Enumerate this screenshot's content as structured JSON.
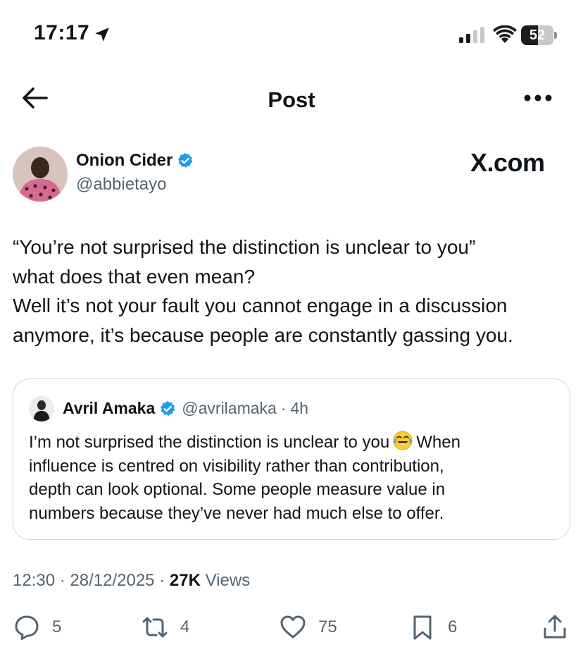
{
  "status_bar": {
    "time": "17:17",
    "battery_level": "52",
    "battery_fraction": 0.52
  },
  "header": {
    "title": "Post"
  },
  "author": {
    "name": "Onion Cider",
    "handle": "@abbietayo",
    "verified": true
  },
  "watermark": "X.com",
  "tweet": {
    "lines": [
      "“You’re not surprised the distinction is unclear to you”",
      "what does that even mean?",
      "Well it’s not your fault you cannot engage in a discussion",
      "anymore, it’s because people are constantly gassing you."
    ]
  },
  "quote": {
    "name": "Avril Amaka",
    "handle": "@avrilamaka",
    "separator": "·",
    "time": "4h",
    "line1_before_emoji": "I’m not surprised the distinction is unclear to you",
    "line1_after_emoji": "When",
    "lines": [
      "influence is centred on visibility rather than contribution,",
      "depth can look optional. Some people measure value in",
      "numbers because they’ve never had much else to offer."
    ],
    "emoji": "face-with-tears-of-joy"
  },
  "meta": {
    "time": "12:30",
    "sep1": "·",
    "date": "28/12/2025",
    "sep2": "·",
    "views_count": "27K",
    "views_label": "Views"
  },
  "actions": {
    "replies": "5",
    "reposts": "4",
    "likes": "75",
    "bookmarks": "6"
  },
  "colors": {
    "text": "#0f1419",
    "secondary": "#536471",
    "verified_blue": "#1d9bf0",
    "border": "#cfd9de"
  }
}
